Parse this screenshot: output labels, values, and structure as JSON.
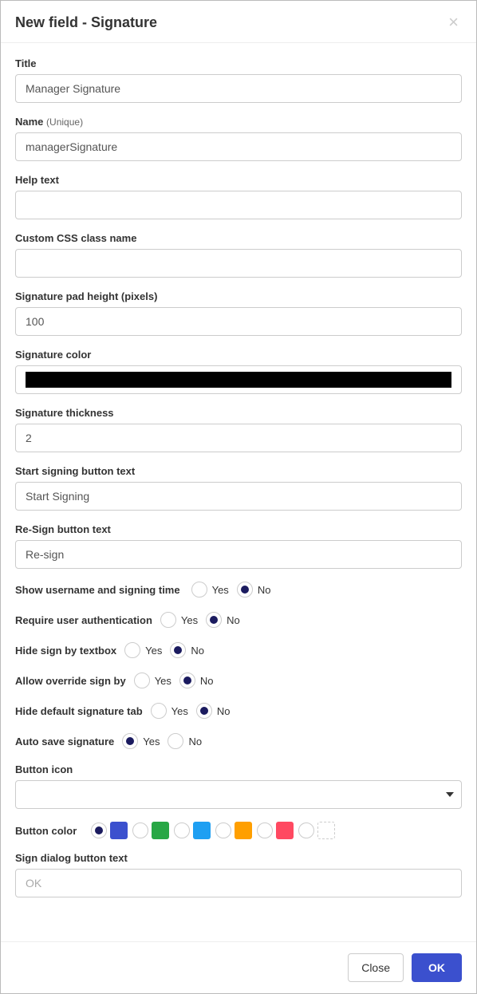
{
  "header": {
    "title": "New field - Signature"
  },
  "labels": {
    "title": "Title",
    "name": "Name",
    "name_hint": "(Unique)",
    "help_text": "Help text",
    "css_class": "Custom CSS class name",
    "pad_height": "Signature pad height (pixels)",
    "sig_color": "Signature color",
    "sig_thickness": "Signature thickness",
    "start_btn": "Start signing button text",
    "resign_btn": "Re-Sign button text",
    "show_user": "Show username and signing time",
    "require_auth": "Require user authentication",
    "hide_signby": "Hide sign by textbox",
    "allow_override": "Allow override sign by",
    "hide_default_tab": "Hide default signature tab",
    "auto_save": "Auto save signature",
    "button_icon": "Button icon",
    "button_color": "Button color",
    "dialog_btn": "Sign dialog button text",
    "yes": "Yes",
    "no": "No"
  },
  "values": {
    "title": "Manager Signature",
    "name": "managerSignature",
    "help_text": "",
    "css_class": "",
    "pad_height": "100",
    "sig_color": "#000000",
    "sig_thickness": "2",
    "start_btn": "Start Signing",
    "resign_btn": "Re-sign",
    "show_user": "No",
    "require_auth": "No",
    "hide_signby": "No",
    "allow_override": "No",
    "hide_default_tab": "No",
    "auto_save": "Yes",
    "button_icon": "",
    "button_color": "default",
    "dialog_btn_placeholder": "OK"
  },
  "button_colors": [
    "default",
    "green",
    "blue",
    "orange",
    "red",
    "white"
  ],
  "footer": {
    "close": "Close",
    "ok": "OK"
  }
}
